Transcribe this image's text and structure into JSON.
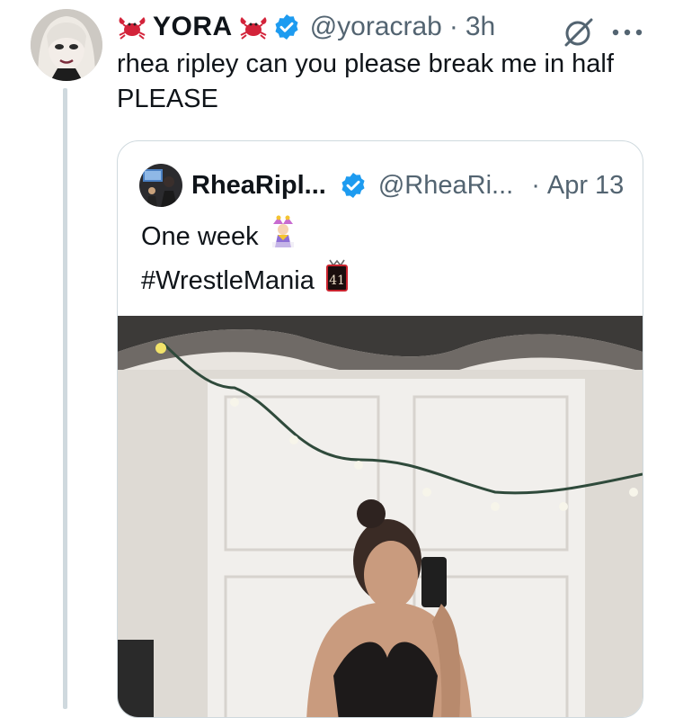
{
  "tweet": {
    "author_name": "YORA",
    "author_handle": "@yoracrab",
    "separator": "·",
    "time": "3h",
    "text_line1": "rhea ripley can you please break me in half",
    "text_line2": "PLEASE"
  },
  "quoted": {
    "author_name": "RheaRipl...",
    "author_handle": "@RheaRi...",
    "separator": "·",
    "date": "Apr 13",
    "text_line1": "One week",
    "text_line2": "#WrestleMania",
    "badge_number": "41"
  },
  "icons": {
    "crab": "crab-emoji-icon",
    "verified": "verified-badge-icon",
    "grok": "grok-icon",
    "more": "more-options-icon",
    "jester": "jester-emoji-icon",
    "wrestlemania": "wrestlemania-41-icon"
  },
  "colors": {
    "verified_blue": "#1d9bf0",
    "secondary_text": "#536471",
    "crab_red": "#d3233a",
    "border": "#cfd9de"
  }
}
